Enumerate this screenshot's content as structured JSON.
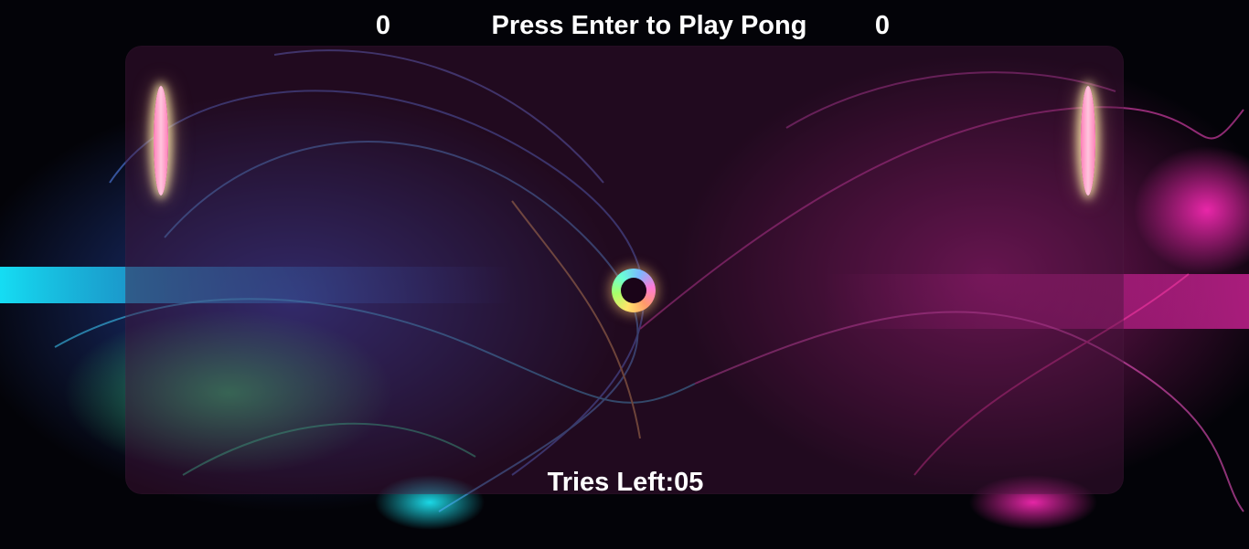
{
  "scoreboard": {
    "left_score": "0",
    "right_score": "0",
    "message": "Press Enter to Play Pong"
  },
  "status": {
    "tries_left": "Tries Left:05"
  },
  "colors": {
    "paddle": "#ff9fcc",
    "paddle_glow": "#ffebaa",
    "board_tint": "#46143c",
    "text": "#ffffff"
  },
  "icons": {
    "ball": "ball-icon",
    "paddle_left": "left-paddle",
    "paddle_right": "right-paddle"
  }
}
